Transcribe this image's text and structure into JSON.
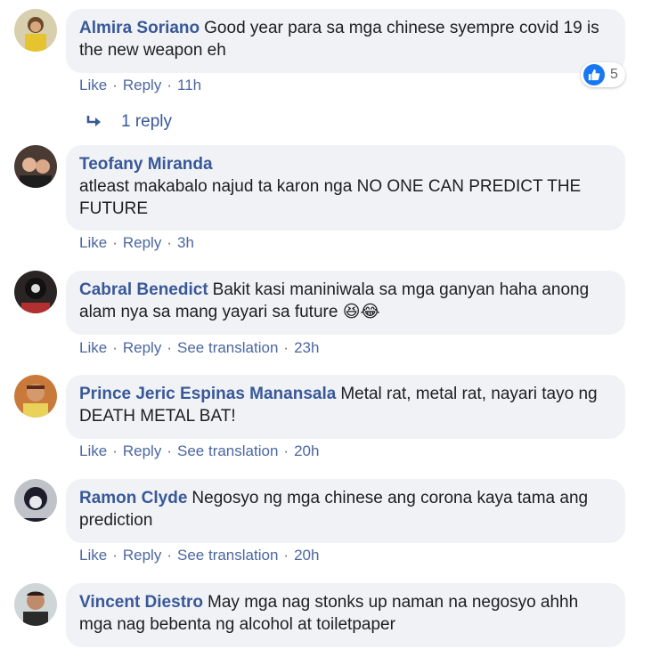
{
  "comments": [
    {
      "author": "Almira Soriano",
      "text": "Good year para sa mga chinese syempre covid 19 is the new weapon eh",
      "actions": {
        "like": "Like",
        "reply": "Reply",
        "time": "11h"
      },
      "reaction_count": "5",
      "replies_label": "1 reply"
    },
    {
      "author": "Teofany Miranda",
      "text": "atleast makabalo najud ta karon nga NO ONE CAN PREDICT THE FUTURE",
      "actions": {
        "like": "Like",
        "reply": "Reply",
        "time": "3h"
      }
    },
    {
      "author": "Cabral Benedict",
      "text": "Bakit kasi maniniwala sa mga ganyan haha anong alam nya sa mang yayari sa future",
      "emojis": "😆😂",
      "actions": {
        "like": "Like",
        "reply": "Reply",
        "translate": "See translation",
        "time": "23h"
      }
    },
    {
      "author": "Prince Jeric Espinas Manansala",
      "text": "Metal rat, metal rat, nayari tayo ng DEATH METAL BAT!",
      "actions": {
        "like": "Like",
        "reply": "Reply",
        "translate": "See translation",
        "time": "20h"
      }
    },
    {
      "author": "Ramon Clyde",
      "text": "Negosyo ng mga chinese ang corona kaya tama ang prediction",
      "actions": {
        "like": "Like",
        "reply": "Reply",
        "translate": "See translation",
        "time": "20h"
      }
    },
    {
      "author": "Vincent Diestro",
      "text": "May mga nag stonks up naman na negosyo ahhh mga nag bebenta ng alcohol at toiletpaper"
    }
  ],
  "colors": {
    "author": "#385898",
    "action_link": "#4b67a1",
    "bubble_bg": "#f0f2f5",
    "like_blue": "#1877f2"
  },
  "icons": [
    "like-icon",
    "reply-arrow-icon"
  ]
}
